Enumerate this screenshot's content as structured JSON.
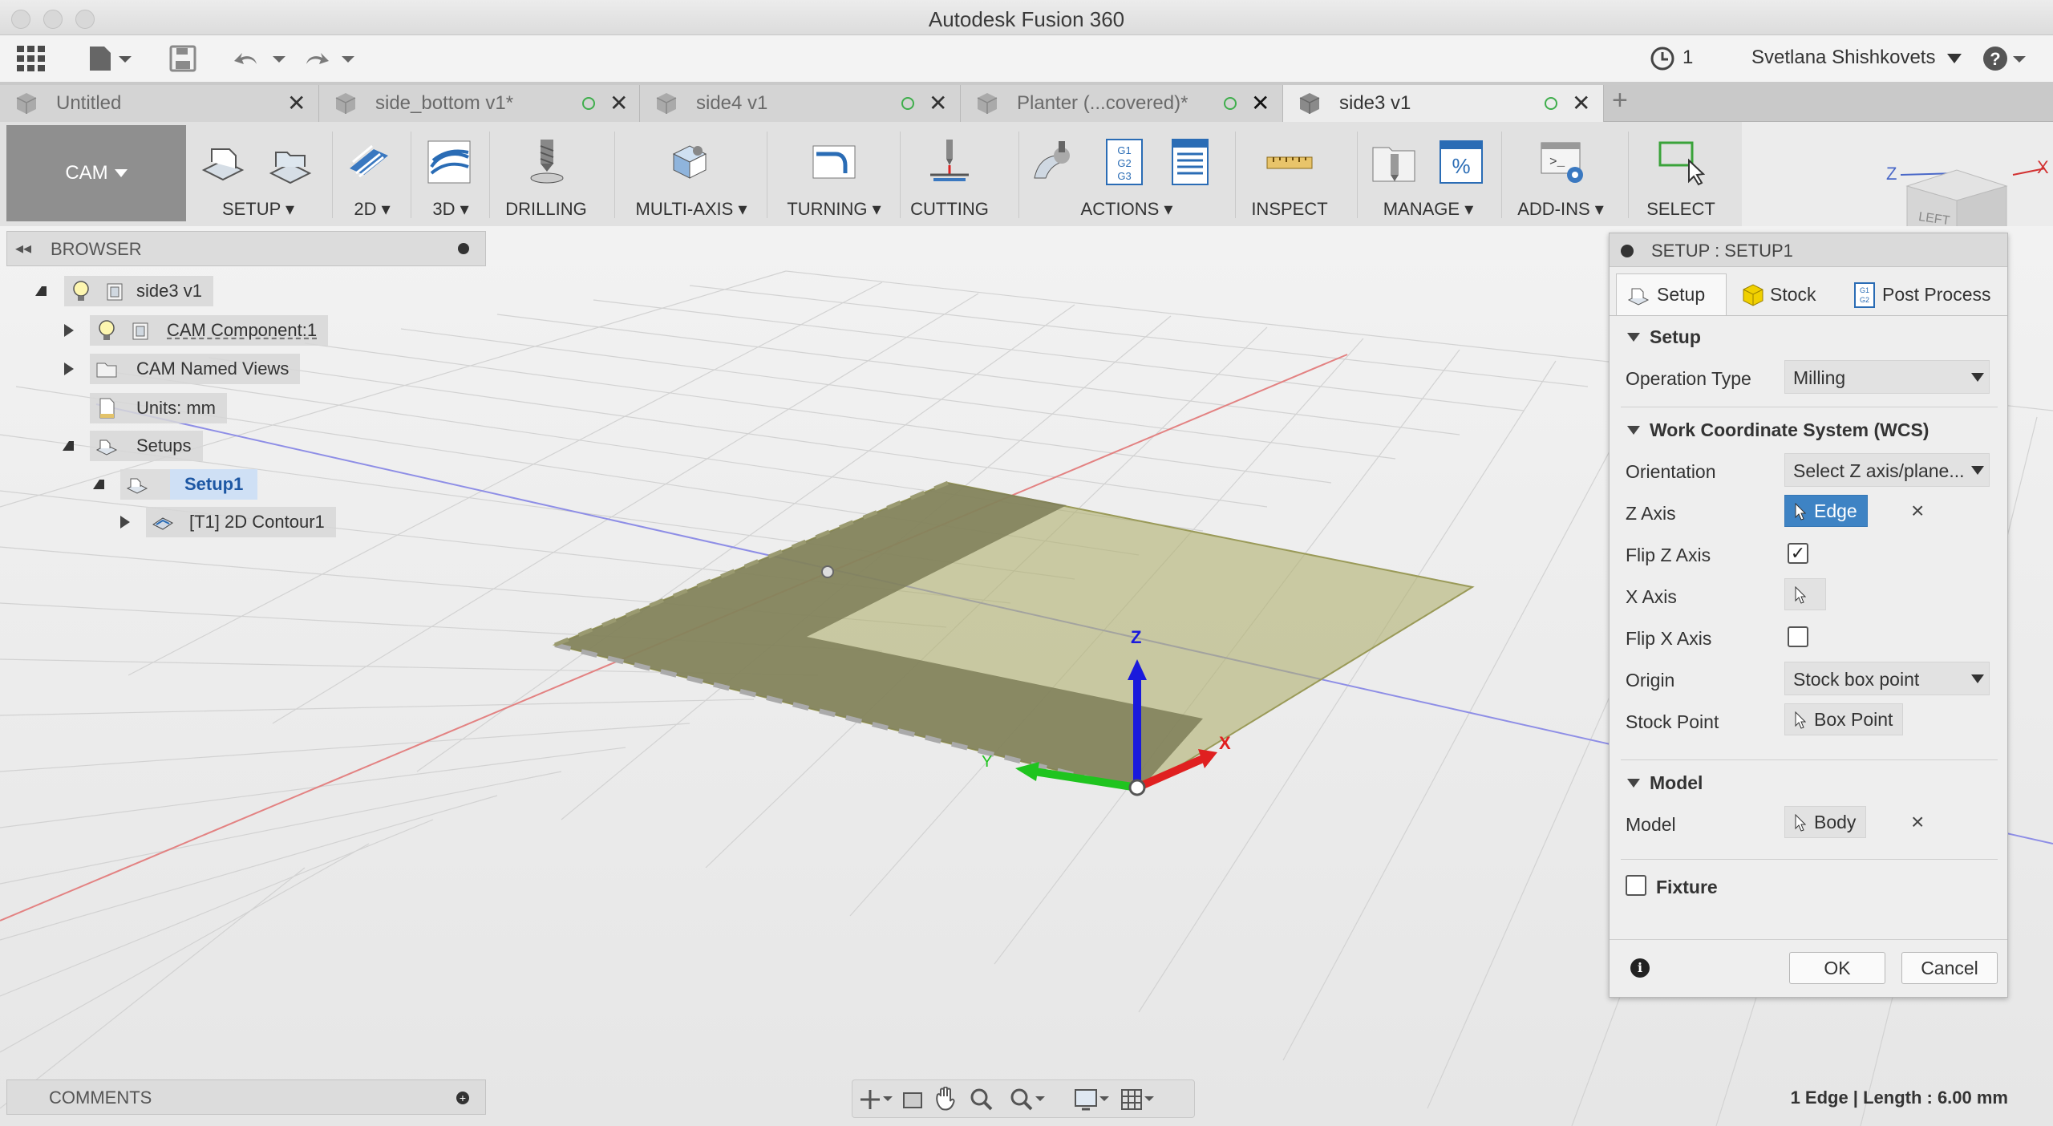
{
  "window": {
    "title": "Autodesk Fusion 360"
  },
  "quick_access": {
    "job_count": "1",
    "user_name": "Svetlana Shishkovets",
    "help_icon": "help-icon"
  },
  "tabs": [
    {
      "label": "Untitled"
    },
    {
      "label": "side_bottom v1*"
    },
    {
      "label": "side4 v1"
    },
    {
      "label": "Planter (...covered)*"
    },
    {
      "label": "side3 v1"
    }
  ],
  "ribbon": {
    "workspace": "CAM",
    "groups": {
      "setup": "SETUP",
      "two_d": "2D",
      "three_d": "3D",
      "drilling": "DRILLING",
      "multi_axis": "MULTI-AXIS",
      "turning": "TURNING",
      "cutting": "CUTTING",
      "actions": "ACTIONS",
      "inspect": "INSPECT",
      "manage": "MANAGE",
      "add_ins": "ADD-INS",
      "select": "SELECT"
    }
  },
  "browser": {
    "title": "BROWSER",
    "items": [
      {
        "label": "side3 v1"
      },
      {
        "label": "CAM Component:1"
      },
      {
        "label": "CAM Named Views"
      },
      {
        "label": "Units: mm"
      },
      {
        "label": "Setups"
      },
      {
        "label": "Setup1"
      },
      {
        "label": "[T1] 2D Contour1"
      }
    ]
  },
  "comments": {
    "title": "COMMENTS"
  },
  "status_bar": {
    "text": "1 Edge | Length : 6.00 mm"
  },
  "viewport": {
    "axis_z": "Z",
    "axis_x": "X",
    "axis_y": "Y",
    "viewcube_face": "LEFT"
  },
  "dialog": {
    "title": "SETUP : SETUP1",
    "tabs": {
      "setup": "Setup",
      "stock": "Stock",
      "post": "Post Process"
    },
    "sections": {
      "setup": "Setup",
      "wcs": "Work Coordinate System (WCS)",
      "model": "Model",
      "fixture": "Fixture"
    },
    "fields": {
      "operation_type_label": "Operation Type",
      "operation_type_value": "Milling",
      "orientation_label": "Orientation",
      "orientation_value": "Select Z axis/plane...",
      "z_axis_label": "Z Axis",
      "z_axis_value": "Edge",
      "flip_z_label": "Flip Z Axis",
      "flip_z_checked": true,
      "x_axis_label": "X Axis",
      "flip_x_label": "Flip X Axis",
      "flip_x_checked": false,
      "origin_label": "Origin",
      "origin_value": "Stock box point",
      "stock_point_label": "Stock Point",
      "stock_point_value": "Box Point",
      "model_label": "Model",
      "model_value": "Body",
      "fixture_checked": false
    },
    "buttons": {
      "ok": "OK",
      "cancel": "Cancel"
    }
  },
  "colors": {
    "accent": "#3e83c4",
    "x_axis": "#e02020",
    "y_axis": "#1fc41f",
    "z_axis": "#1a1adc",
    "stock": "#9a9a58"
  }
}
